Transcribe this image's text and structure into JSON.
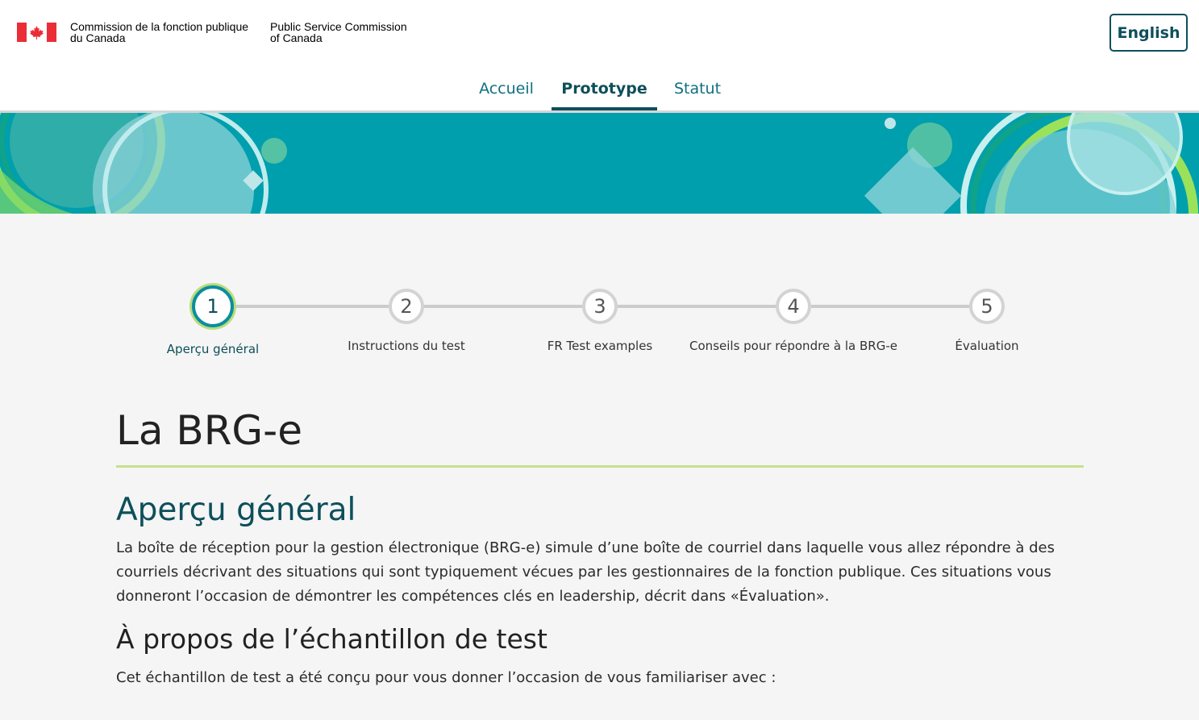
{
  "header": {
    "signature_fr_line1": "Commission de la fonction publique",
    "signature_fr_line2": "du Canada",
    "signature_en_line1": "Public Service Commission",
    "signature_en_line2": "of Canada",
    "language_button": "English"
  },
  "nav": {
    "items": [
      {
        "label": "Accueil",
        "active": false
      },
      {
        "label": "Prototype",
        "active": true
      },
      {
        "label": "Statut",
        "active": false
      }
    ]
  },
  "stepper": {
    "steps": [
      {
        "number": "1",
        "label": "Aperçu général",
        "active": true
      },
      {
        "number": "2",
        "label": "Instructions du test",
        "active": false
      },
      {
        "number": "3",
        "label": "FR Test examples",
        "active": false
      },
      {
        "number": "4",
        "label": "Conseils pour répondre à la BRG-e",
        "active": false
      },
      {
        "number": "5",
        "label": "Évaluation",
        "active": false
      }
    ]
  },
  "content": {
    "page_title": "La BRG-e",
    "section_title": "Aperçu général",
    "paragraph": "La boîte de réception pour la gestion électronique (BRG-e) simule d’une boîte de courriel dans laquelle vous allez répondre à des courriels décrivant des situations qui sont typiquement vécues par les gestionnaires de la fonction publique. Ces situations vous donneront l’occasion de démontrer les compétences clés en leadership, décrit dans «Évaluation».",
    "sub_title": "À propos de l’échantillon de test",
    "intro": "Cet échantillon de test a été conçu pour vous donner l’occasion de vous familiariser avec :"
  },
  "colors": {
    "brand_dark": "#0d4f5a",
    "brand_link": "#0f6f82",
    "banner_teal": "#009fad",
    "accent_green": "#b9dc7e",
    "flag_red": "#eb2d37"
  }
}
